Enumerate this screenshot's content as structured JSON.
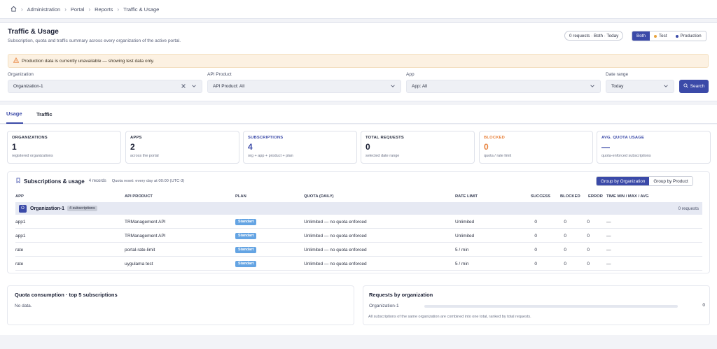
{
  "breadcrumb": [
    "Administration",
    "Portal",
    "Reports",
    "Traffic & Usage"
  ],
  "header": {
    "title": "Traffic & Usage",
    "subtitle": "Subscription, quota and traffic summary across every organization of the active portal.",
    "requests_pill": "0 requests · Both · Today",
    "env_toggle": [
      {
        "label": "Both",
        "active": true
      },
      {
        "label": "Test",
        "dot_color": "#e8a33d"
      },
      {
        "label": "Production",
        "dot_color": "#3b4aa8"
      }
    ],
    "alert": "Production data is currently unavailable — showing test data only."
  },
  "filters": {
    "organization": {
      "label": "Organization",
      "value": "Organization-1"
    },
    "api_product": {
      "label": "API Product",
      "value": "API Product: All"
    },
    "app": {
      "label": "App",
      "value": "App: All"
    },
    "date_range": {
      "label": "Date range",
      "value": "Today"
    },
    "search_label": "Search"
  },
  "tabs": [
    "Usage",
    "Traffic"
  ],
  "stats": [
    {
      "label": "ORGANIZATIONS",
      "value": "1",
      "desc": "registered organizations",
      "color": "#1b2035",
      "label_color": "#2b3042"
    },
    {
      "label": "APPS",
      "value": "2",
      "desc": "across the portal",
      "color": "#1b2035",
      "label_color": "#2b3042"
    },
    {
      "label": "SUBSCRIPTIONS",
      "value": "4",
      "desc": "org + app + product + plan",
      "color": "#3b4aa8",
      "label_color": "#3b4aa8"
    },
    {
      "label": "TOTAL REQUESTS",
      "value": "0",
      "desc": "selected date range",
      "color": "#1b2035",
      "label_color": "#2b3042"
    },
    {
      "label": "BLOCKED",
      "value": "0",
      "desc": "quota / rate limit",
      "color": "#e8823d",
      "label_color": "#e8823d"
    },
    {
      "label": "AVG. QUOTA USAGE",
      "value": "—",
      "desc": "quota-enforced subscriptions",
      "color": "#3b4aa8",
      "label_color": "#3b4aa8"
    }
  ],
  "subscriptions": {
    "title": "Subscriptions & usage",
    "records": "4 records",
    "quota_reset": "Quota reset: every day at 00:00 (UTC-3)",
    "group_by": [
      {
        "label": "Group by Organization",
        "active": true
      },
      {
        "label": "Group by Product"
      }
    ],
    "columns": [
      "APP",
      "API PRODUCT",
      "PLAN",
      "QUOTA (DAILY)",
      "RATE LIMIT",
      "SUCCESS",
      "BLOCKED",
      "ERROR",
      "TIME MIN / MAX / AVG"
    ],
    "group": {
      "badge": "O",
      "name": "Organization-1",
      "count": "4 subscriptions",
      "requests": "0 requests"
    },
    "rows": [
      {
        "app": "app1",
        "product": "TRManagement API",
        "plan": "Standart",
        "quota": "Unlimited — no quota enforced",
        "rate": "Unlimited",
        "success": "0",
        "blocked": "0",
        "error": "0",
        "time": "—"
      },
      {
        "app": "app1",
        "product": "TRManagement API",
        "plan": "Standart",
        "quota": "Unlimited — no quota enforced",
        "rate": "Unlimited",
        "success": "0",
        "blocked": "0",
        "error": "0",
        "time": "—"
      },
      {
        "app": "rate",
        "product": "portal-rate-limit",
        "plan": "Standart",
        "quota": "Unlimited — no quota enforced",
        "rate": "5 / min",
        "success": "0",
        "blocked": "0",
        "error": "0",
        "time": "—"
      },
      {
        "app": "rate",
        "product": "uygulama test",
        "plan": "Standart",
        "quota": "Unlimited — no quota enforced",
        "rate": "5 / min",
        "success": "0",
        "blocked": "0",
        "error": "0",
        "time": "—"
      }
    ]
  },
  "quota_card": {
    "title": "Quota consumption · top 5 subscriptions",
    "empty": "No data."
  },
  "org_card": {
    "title": "Requests by organization",
    "org": "Organization-1",
    "value": "0",
    "fill": 0,
    "note": "All subscriptions of the same organization are combined into one total, ranked by total requests."
  }
}
